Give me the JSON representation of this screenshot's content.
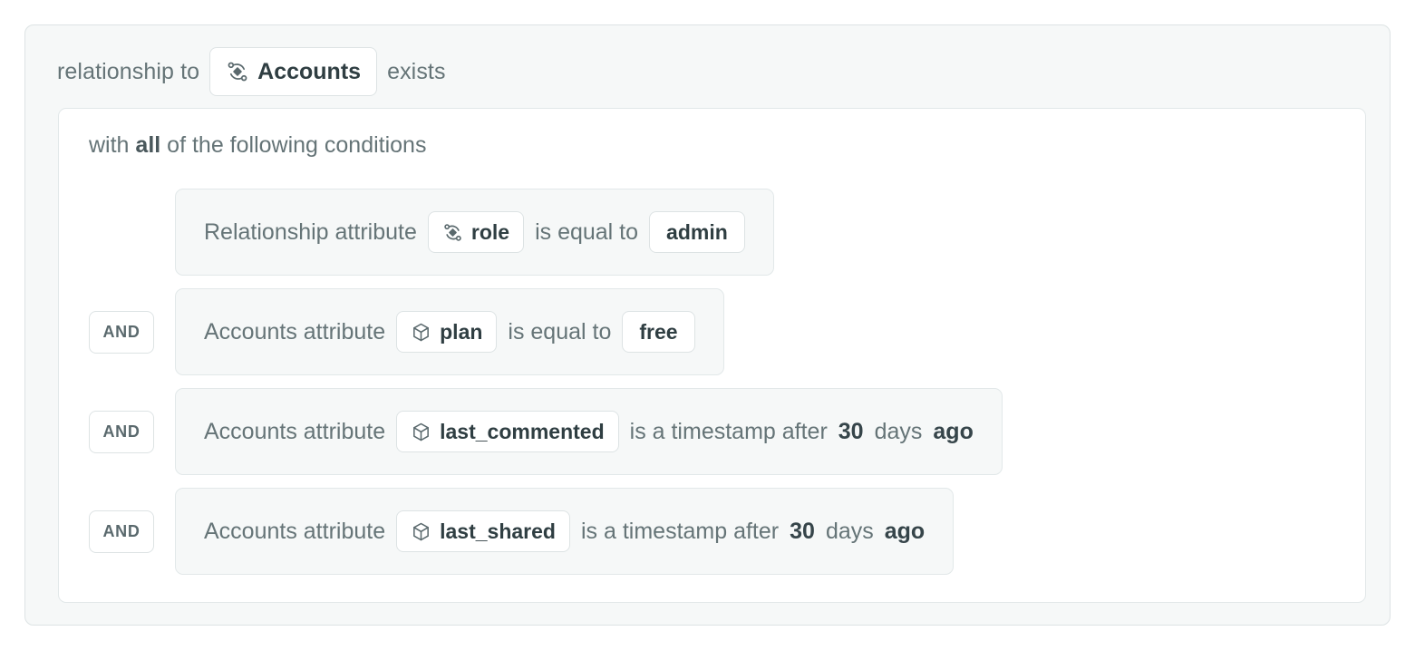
{
  "rule": {
    "header": {
      "prefix": "relationship to",
      "entity": {
        "label": "Accounts",
        "icon": "relationship-icon"
      },
      "suffix": "exists"
    },
    "conditions_panel": {
      "title_prefix": "with",
      "title_operator": "all",
      "title_suffix": "of the following conditions",
      "join_operator": "AND",
      "conditions": [
        {
          "subject": "Relationship attribute",
          "attribute": {
            "label": "role",
            "icon": "relationship-icon"
          },
          "operator": "is equal to",
          "value_chip": "admin",
          "trailing": []
        },
        {
          "subject": "Accounts attribute",
          "attribute": {
            "label": "plan",
            "icon": "cube-icon"
          },
          "operator": "is equal to",
          "value_chip": "free",
          "trailing": []
        },
        {
          "subject": "Accounts attribute",
          "attribute": {
            "label": "last_commented",
            "icon": "cube-icon"
          },
          "operator": "is a timestamp after",
          "value_chip": null,
          "trailing": [
            {
              "text": "30",
              "strong": true
            },
            {
              "text": "days",
              "strong": false
            },
            {
              "text": "ago",
              "strong": true
            }
          ]
        },
        {
          "subject": "Accounts attribute",
          "attribute": {
            "label": "last_shared",
            "icon": "cube-icon"
          },
          "operator": "is a timestamp after",
          "value_chip": null,
          "trailing": [
            {
              "text": "30",
              "strong": true
            },
            {
              "text": "days",
              "strong": false
            },
            {
              "text": "ago",
              "strong": true
            }
          ]
        }
      ]
    }
  },
  "colors": {
    "panel_bg": "#f6f8f8",
    "panel_border": "#dde3e4",
    "chip_bg": "#ffffff",
    "text_muted": "#657477",
    "text_strong": "#36454a"
  }
}
